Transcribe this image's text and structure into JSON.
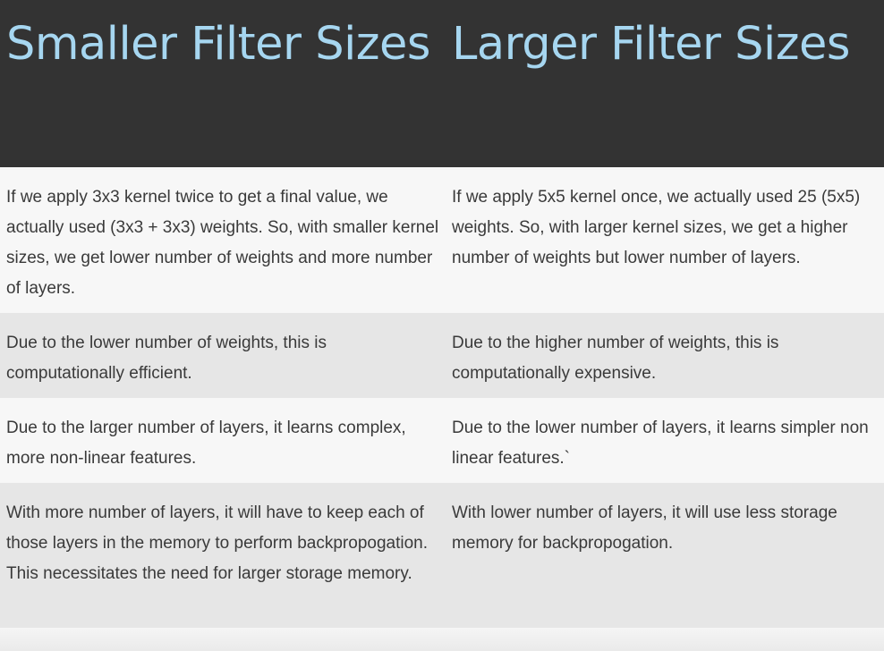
{
  "table": {
    "headers": [
      "Smaller Filter Sizes",
      "Larger Filter Sizes"
    ],
    "rows": [
      [
        "If we apply 3x3 kernel twice to get a final value, we actually used (3x3 + 3x3) weights. So, with smaller kernel sizes, we get lower number of weights and more number of layers.",
        "If we apply 5x5 kernel once, we actually used 25 (5x5) weights. So, with larger kernel sizes, we get a higher number of weights but lower number of layers."
      ],
      [
        "Due to the lower number of weights, this is computationally efficient.",
        "Due to the higher number of weights, this is computationally expensive."
      ],
      [
        "Due to the larger number of layers, it learns complex, more non-linear features.",
        "Due to the lower number of layers, it learns simpler non linear features.`"
      ],
      [
        "With more number of layers, it will have to keep each of those layers in the memory to perform backpropogation. This necessitates the need for larger storage memory.",
        "With lower number of layers, it will use less storage memory for backpropogation."
      ]
    ]
  },
  "colors": {
    "header_bg": "#333333",
    "header_text": "#a6d6f0",
    "row_light": "#f7f7f7",
    "row_dark": "#e6e6e6",
    "body_text": "#3a3a3a"
  }
}
